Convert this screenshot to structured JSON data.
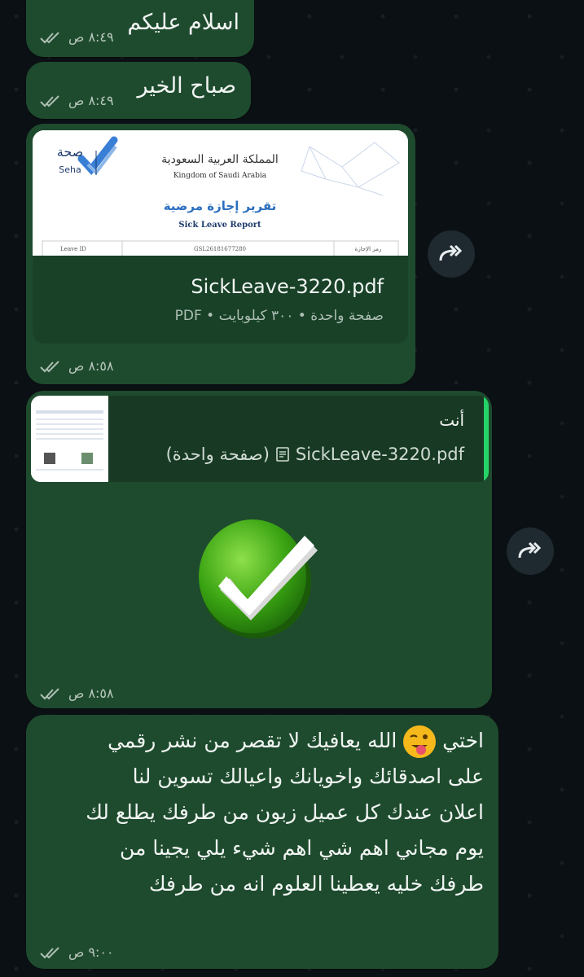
{
  "messages": [
    {
      "text": "اسلام عليكم",
      "time": "٨:٤٩ ص"
    },
    {
      "text": "صباح الخير",
      "time": "٨:٤٩ ص"
    },
    {
      "time": "٨:٥٨ ص"
    },
    {
      "time": "٨:٥٨ ص"
    },
    {
      "time": "٩:٠٠ ص"
    }
  ],
  "document": {
    "file_name": "SickLeave-3220.pdf",
    "info": "صفحة واحدة • ٣٠٠ كيلوبايت • PDF",
    "preview": {
      "brand_ar": "صحة",
      "brand_en": "Seha",
      "kingdom_ar": "المملكة العربية السعودية",
      "kingdom_en": "Kingdom of Saudi Arabia",
      "report_ar": "تقرير إجازة مرضية",
      "report_en": "Sick Leave Report",
      "leave_id_label": "Leave ID",
      "leave_id_value": "GSL26181677280",
      "leave_code_ar": "رمز الإجازة"
    }
  },
  "reply": {
    "sender": "أنت",
    "file_name": "SickLeave-3220.pdf",
    "pages": "(صفحة واحدة)"
  },
  "long_message": {
    "lines": [
      "اختي",
      "الله يعافيك لا تقصر من نشر رقمي",
      "على اصدقائك واخويانك واعيالك تسوين لنا",
      "اعلان عندك كل عميل زبون من طرفك يطلع لك",
      "يوم مجاني اهم شي اهم شيء يلي يجينا من",
      "طرفك خليه يعطينا العلوم انه من طرفك"
    ]
  },
  "colors": {
    "bubble": "#1e4b2e",
    "accent": "#25d366",
    "background": "#0b1014"
  }
}
